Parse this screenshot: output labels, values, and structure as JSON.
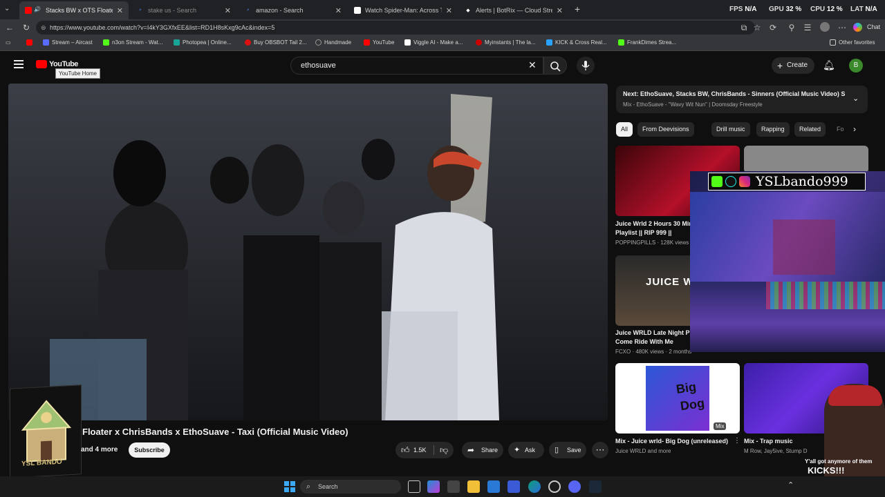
{
  "browser": {
    "tabs": [
      {
        "label": "Stacks BW x OTS Floater x Ch",
        "active": true
      },
      {
        "label": "stake us - Search",
        "active": false
      },
      {
        "label": "amazon - Search",
        "active": false
      },
      {
        "label": "Watch Spider-Man: Across The Sp",
        "active": false
      },
      {
        "label": "Alerts | BotRix — Cloud Streaming",
        "active": false
      }
    ],
    "hud": {
      "fps_label": "FPS",
      "fps_value": "N/A",
      "gpu_label": "GPU",
      "gpu_value": "32 %",
      "cpu_label": "CPU",
      "cpu_value": "12 %",
      "lat_label": "LAT",
      "lat_value": "N/A"
    },
    "url": "https://www.youtube.com/watch?v=I4kY3GXfxEE&list=RD1H8sKxg9cAc&index=5",
    "chat_label": "Chat",
    "bookmarks": [
      {
        "label": "Stream – Aircast",
        "color": "#5a6cff"
      },
      {
        "label": "n3on Stream - Wat...",
        "color": "#53fc18"
      },
      {
        "label": "Photopea | Online...",
        "color": "#18a497"
      },
      {
        "label": "Buy OBSBOT Tail 2...",
        "color": "#d11"
      },
      {
        "label": "Handmade",
        "color": "#999"
      },
      {
        "label": "YouTube",
        "color": "#f00"
      },
      {
        "label": "Viggle AI - Make a...",
        "color": "#fff"
      },
      {
        "label": "Myinstants | The la...",
        "color": "#c00"
      },
      {
        "label": "KICK & Cross Real...",
        "color": "#29a3ff"
      },
      {
        "label": "FrankDimes Strea...",
        "color": "#53fc18"
      }
    ],
    "other_favorites": "Other favorites"
  },
  "youtube": {
    "logo": "YouTube",
    "tooltip": "YouTube Home",
    "search_value": "ethosuave",
    "create_label": "Create",
    "avatar_letter": "B",
    "video": {
      "title": "Floater x ChrisBands x EthoSuave - Taxi (Official Music Video)",
      "channel_more": "and 4 more",
      "subscribe": "Subscribe",
      "likes": "1.5K",
      "share": "Share",
      "ask": "Ask",
      "save": "Save"
    },
    "up_next": {
      "title": "Next: EthoSuave, Stacks BW, ChrisBands - Sinners (Official Music Video) Sh...",
      "subtitle": "Mix - EthoSuave - \"Wavy Wit Nun\" | Doomsday Freestyle"
    },
    "chips": [
      "All",
      "From Deevisions",
      "Drill music",
      "Rapping",
      "Related",
      "Fo"
    ],
    "recs": [
      {
        "title_line1": "Juice Wrld 2 Hours 30 Min",
        "title_line2": "Playlist || RIP 999 ||",
        "meta": "POPPINGPILLS · 128K views ·"
      },
      {
        "title_line1": "Juice WRLD Late Night Pl",
        "title_line2": "Come Ride With Me",
        "meta": "FCXO · 480K views · 2 months"
      },
      {
        "title_line1": "Mix - Juice wrld- Big Dog (unreleased)",
        "title_line2": "",
        "meta": "Juice WRLD and more",
        "badge": "Mix"
      },
      {
        "title_line1": "Mix - Trap music",
        "title_line2": "",
        "meta": "M Row, Jay5ive, Stump D"
      }
    ],
    "thumb_texts": {
      "juice": "JUICE W",
      "bigdog_1": "Big",
      "bigdog_2": "Dog"
    }
  },
  "overlay": {
    "handle": "YSLbando999",
    "kicks_line1": "Y'all got anymore of them",
    "kicks_line2": "KICKS!!!",
    "sticker_text": "YSL BANDO"
  },
  "taskbar": {
    "search_placeholder": "Search"
  }
}
